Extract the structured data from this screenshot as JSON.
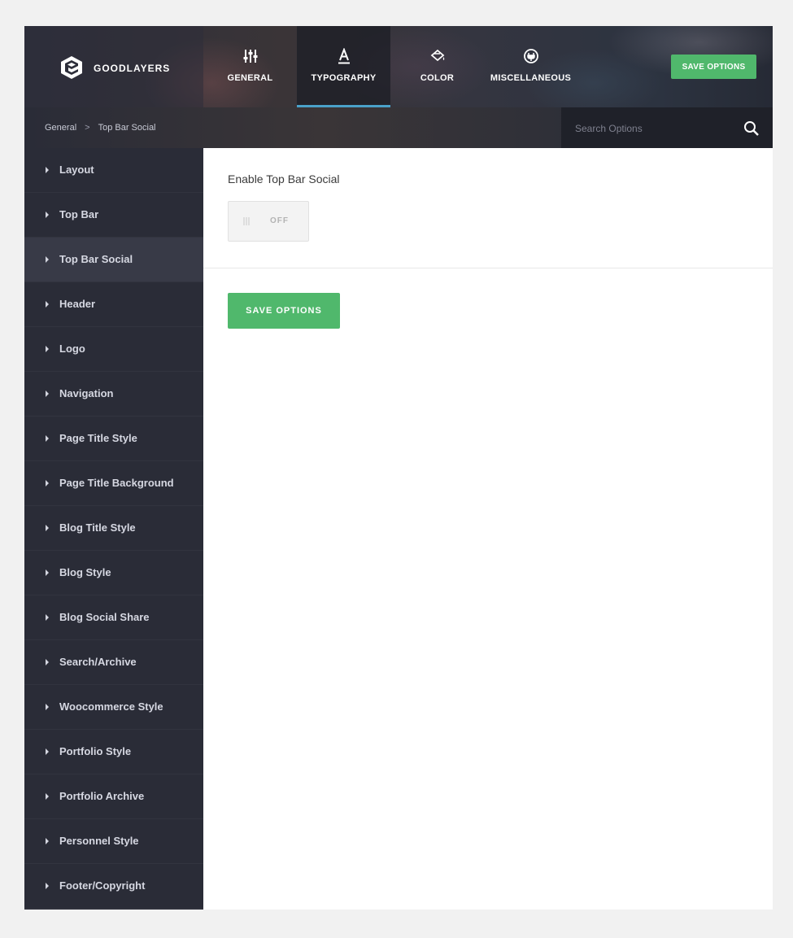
{
  "header": {
    "logo_text": "GOODLAYERS",
    "tabs": [
      {
        "label": "GENERAL",
        "icon": "sliders-icon",
        "active": false
      },
      {
        "label": "TYPOGRAPHY",
        "icon": "typography-icon",
        "active": true
      },
      {
        "label": "COLOR",
        "icon": "paint-bucket-icon",
        "active": false
      },
      {
        "label": "MISCELLANEOUS",
        "icon": "plug-icon",
        "active": false
      }
    ],
    "save_label": "SAVE OPTIONS"
  },
  "breadcrumb": {
    "root": "General",
    "separator": ">",
    "current": "Top Bar Social"
  },
  "search": {
    "placeholder": "Search Options"
  },
  "sidebar": {
    "items": [
      {
        "label": "Layout"
      },
      {
        "label": "Top Bar"
      },
      {
        "label": "Top Bar Social",
        "active": true
      },
      {
        "label": "Header"
      },
      {
        "label": "Logo"
      },
      {
        "label": "Navigation"
      },
      {
        "label": "Page Title Style"
      },
      {
        "label": "Page Title Background"
      },
      {
        "label": "Blog Title Style"
      },
      {
        "label": "Blog Style"
      },
      {
        "label": "Blog Social Share"
      },
      {
        "label": "Search/Archive"
      },
      {
        "label": "Woocommerce Style"
      },
      {
        "label": "Portfolio Style"
      },
      {
        "label": "Portfolio Archive"
      },
      {
        "label": "Personnel Style"
      },
      {
        "label": "Footer/Copyright"
      }
    ]
  },
  "main": {
    "option_title": "Enable Top Bar Social",
    "toggle_label": "OFF",
    "save_label": "SAVE OPTIONS"
  },
  "colors": {
    "accent_green": "#50b86c",
    "active_tab_underline": "#4aa1c9",
    "sidebar_bg": "#2a2c37",
    "sidebar_active": "#383a47"
  }
}
